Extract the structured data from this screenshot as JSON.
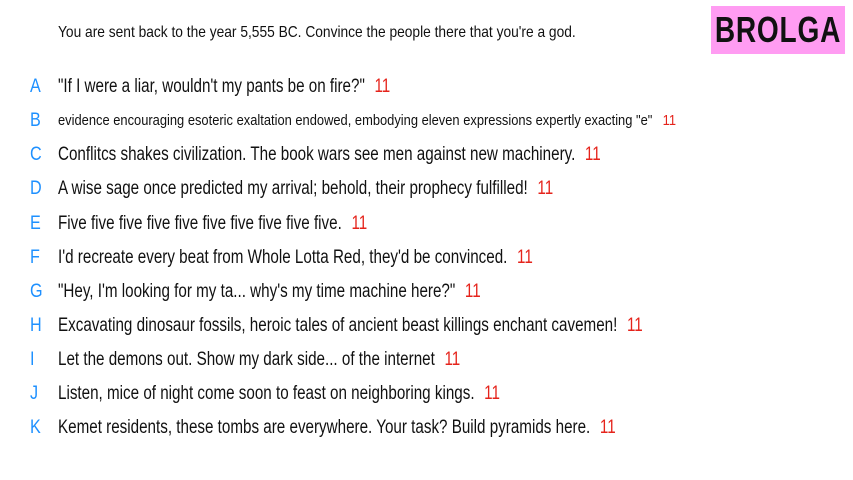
{
  "prompt": "You are sent back to the year 5,555 BC. Convince the people there that you're a god.",
  "brand": "BROLGA",
  "answers": [
    {
      "letter": "A",
      "text": "\"If I were a liar, wouldn't my pants be on fire?\"",
      "score": "11"
    },
    {
      "letter": "B",
      "text": "evidence encouraging esoteric exaltation endowed, embodying eleven expressions expertly exacting \"e\"",
      "score": "11"
    },
    {
      "letter": "C",
      "text": "Conflitcs shakes civilization. The book wars see men against new machinery.",
      "score": "11"
    },
    {
      "letter": "D",
      "text": "A wise sage once predicted my arrival; behold, their prophecy fulfilled!",
      "score": "11"
    },
    {
      "letter": "E",
      "text": "Five five five five five five five five five five.",
      "score": "11"
    },
    {
      "letter": "F",
      "text": "I'd recreate every beat from Whole Lotta Red, they'd be convinced.",
      "score": "11"
    },
    {
      "letter": "G",
      "text": "\"Hey, I'm looking for my ta... why's my time machine here?\"",
      "score": "11"
    },
    {
      "letter": "H",
      "text": "Excavating dinosaur fossils, heroic tales of ancient beast killings enchant cavemen!",
      "score": "11"
    },
    {
      "letter": "I",
      "text": "Let the demons out. Show my dark side... of the internet",
      "score": "11"
    },
    {
      "letter": "J",
      "text": "Listen, mice of night come soon to feast on neighboring kings.",
      "score": "11"
    },
    {
      "letter": "K",
      "text": "Kemet residents, these tombs are everywhere. Your task? Build pyramids here.",
      "score": "11"
    }
  ]
}
